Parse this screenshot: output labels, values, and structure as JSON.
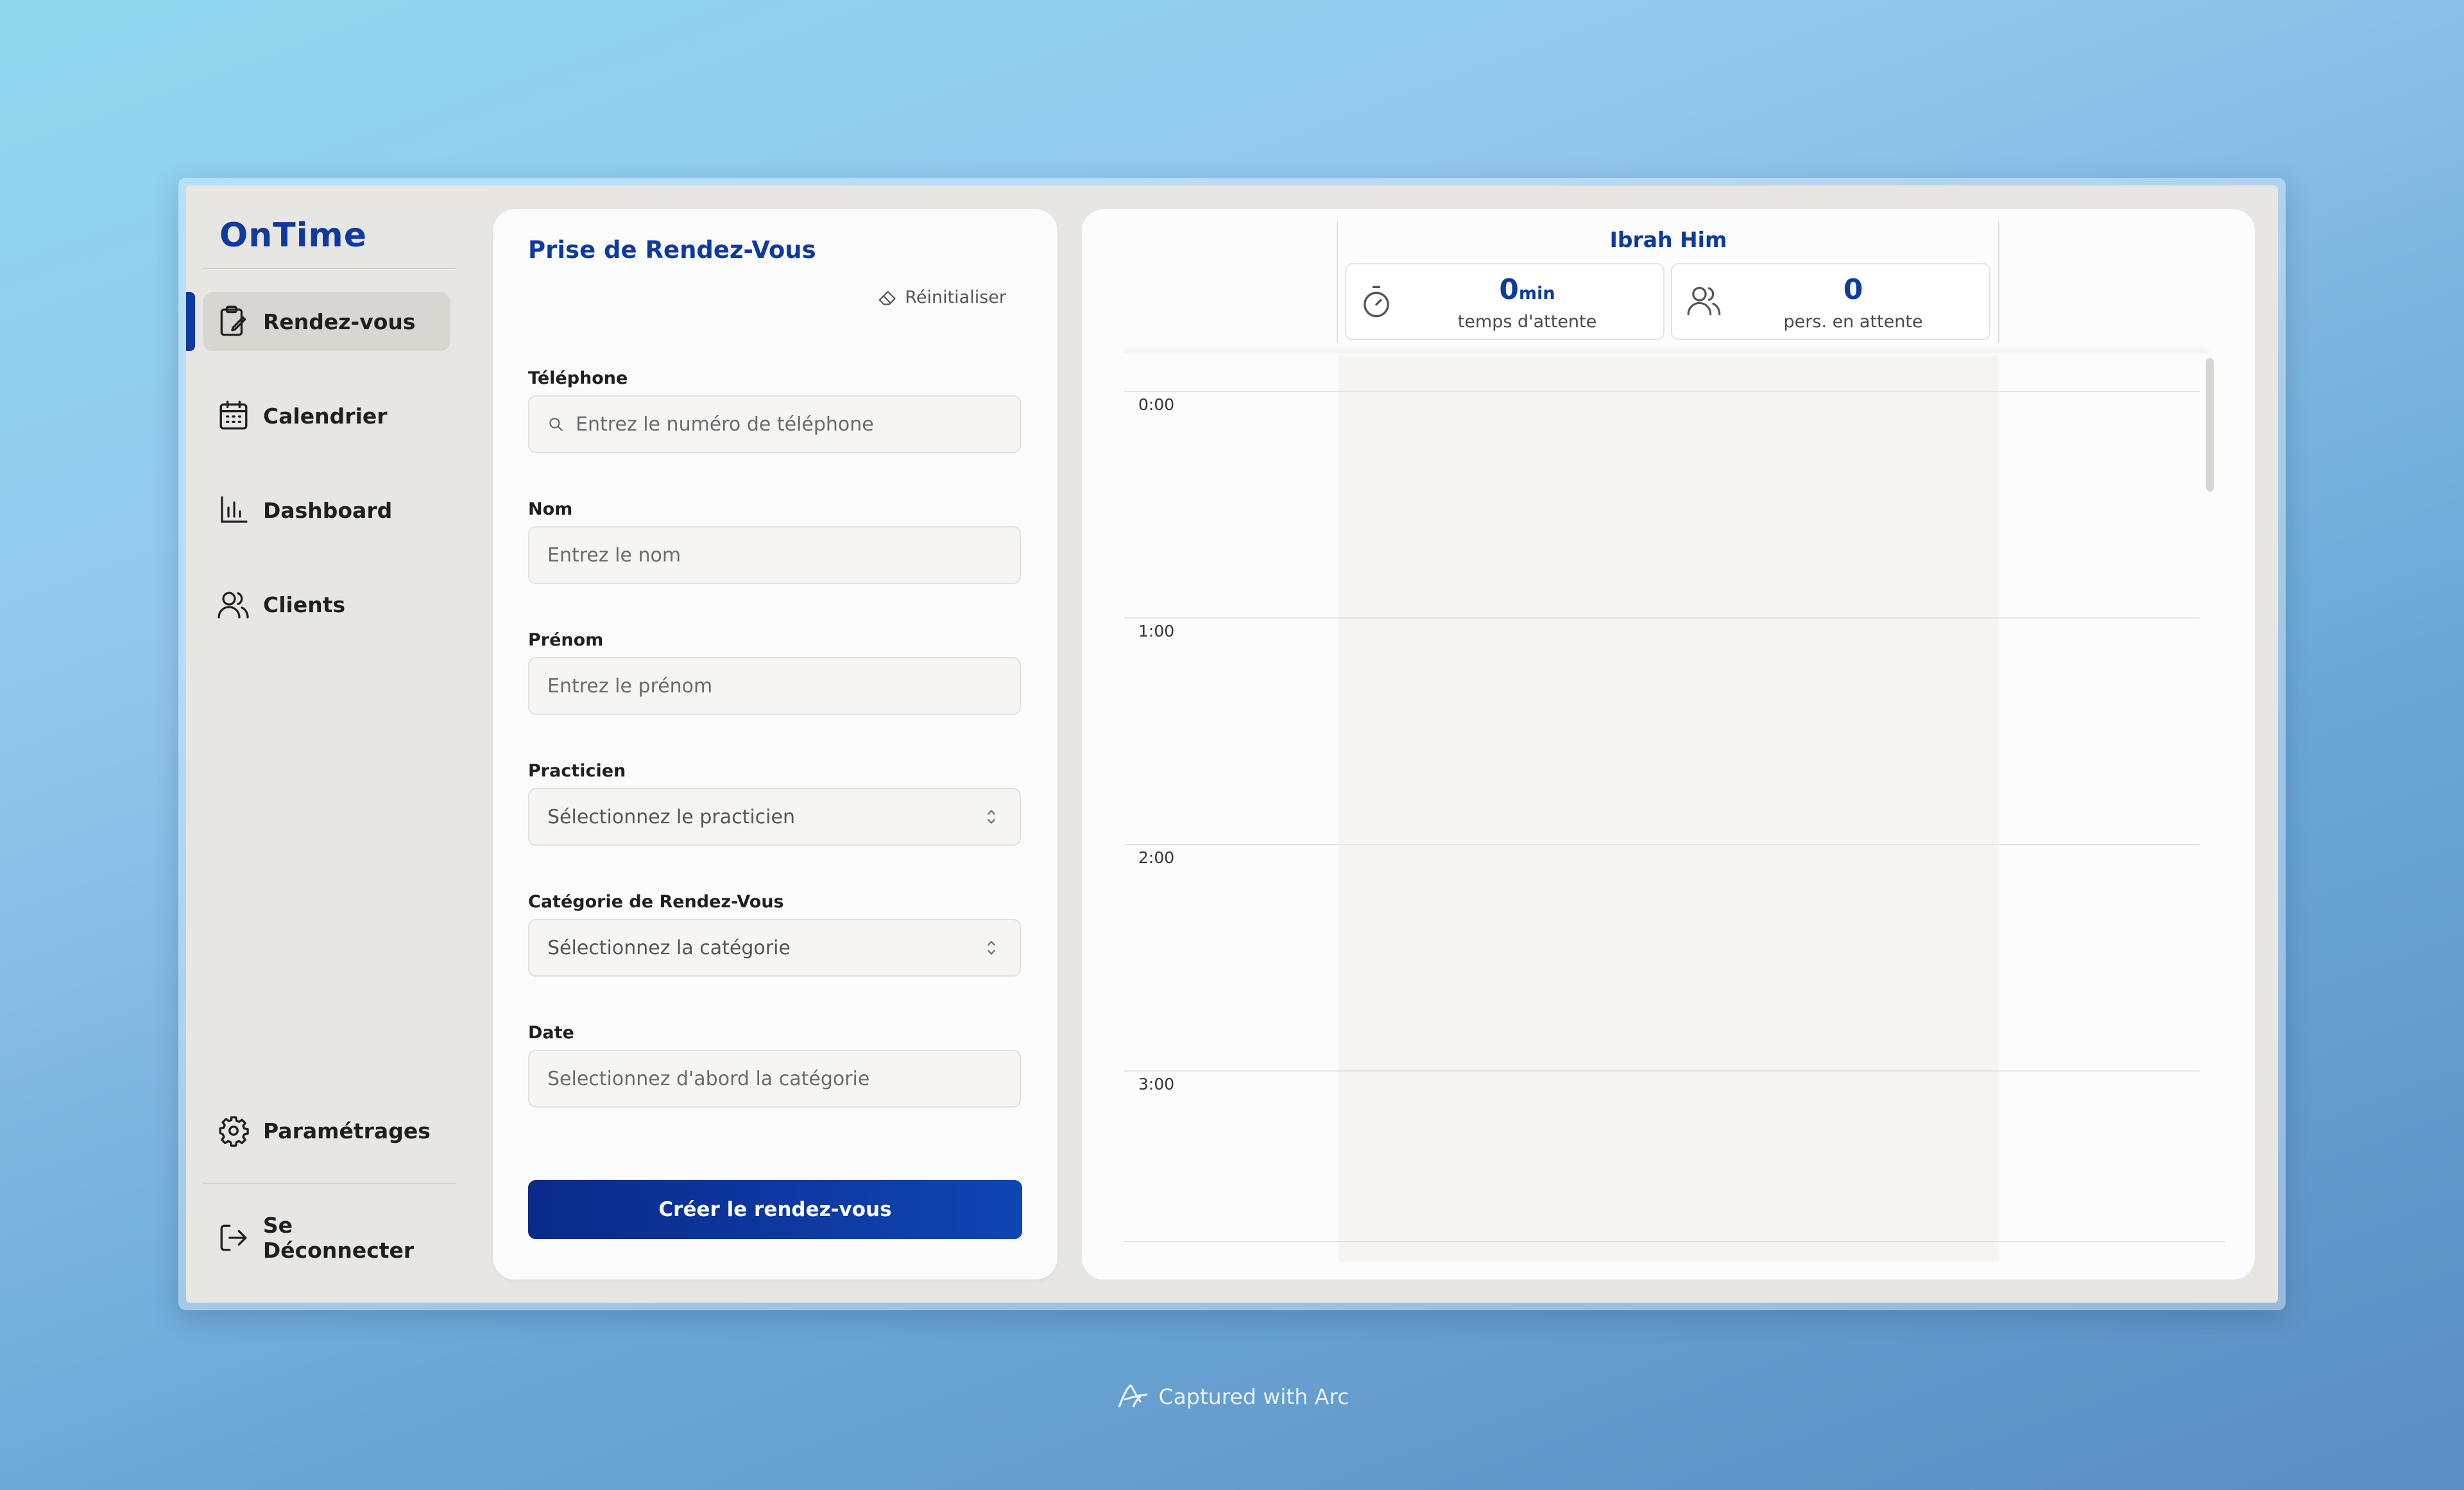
{
  "app": {
    "logo": "OnTime"
  },
  "sidebar": {
    "items": [
      {
        "label": "Rendez-vous",
        "icon": "clipboard-edit-icon",
        "active": true
      },
      {
        "label": "Calendrier",
        "icon": "calendar-icon",
        "active": false
      },
      {
        "label": "Dashboard",
        "icon": "bar-chart-icon",
        "active": false
      },
      {
        "label": "Clients",
        "icon": "users-icon",
        "active": false
      }
    ],
    "settings_label": "Paramétrages",
    "logout_label": "Se Déconnecter"
  },
  "form": {
    "title": "Prise de Rendez-Vous",
    "reset_label": "Réinitialiser",
    "phone": {
      "label": "Téléphone",
      "placeholder": "Entrez le numéro de téléphone"
    },
    "nom": {
      "label": "Nom",
      "placeholder": "Entrez le nom"
    },
    "prenom": {
      "label": "Prénom",
      "placeholder": "Entrez le prénom"
    },
    "practicien": {
      "label": "Practicien",
      "value": "Sélectionnez le practicien"
    },
    "categorie": {
      "label": "Catégorie de Rendez-Vous",
      "value": "Sélectionnez la catégorie"
    },
    "date": {
      "label": "Date",
      "placeholder": "Selectionnez d'abord la catégorie"
    },
    "submit_label": "Créer le rendez-vous"
  },
  "calendar": {
    "practitioner": "Ibrah Him",
    "wait_time": {
      "value": "0",
      "unit": "min",
      "label": "temps d'attente"
    },
    "waiting": {
      "value": "0",
      "label": "pers. en attente"
    },
    "hours": [
      "0:00",
      "1:00",
      "2:00",
      "3:00"
    ]
  },
  "footer": {
    "capture_text": "Captured with Arc"
  },
  "colors": {
    "brand": "#0e3aa0",
    "button": "#0a2a8a"
  }
}
